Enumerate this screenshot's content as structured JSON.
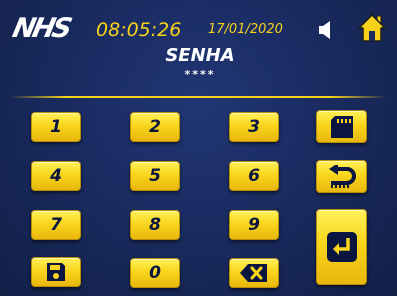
{
  "header": {
    "logo": "NHS",
    "time": "08:05:26",
    "date": "17/01/2020"
  },
  "title": "SENHA",
  "password_mask": "****",
  "keypad": {
    "digits": [
      "1",
      "2",
      "3",
      "4",
      "5",
      "6",
      "7",
      "8",
      "9",
      "0"
    ]
  },
  "icons": {
    "speaker": "speaker-icon",
    "home": "home-icon",
    "sd_card": "sd-card-icon",
    "back": "back-arrow-icon",
    "save": "floppy-disk-icon",
    "backspace": "backspace-icon",
    "enter": "enter-icon"
  },
  "colors": {
    "background": "#1a2a5e",
    "accent": "#f8d21a",
    "key": "#f9d61c",
    "key_text": "#0b1640"
  }
}
